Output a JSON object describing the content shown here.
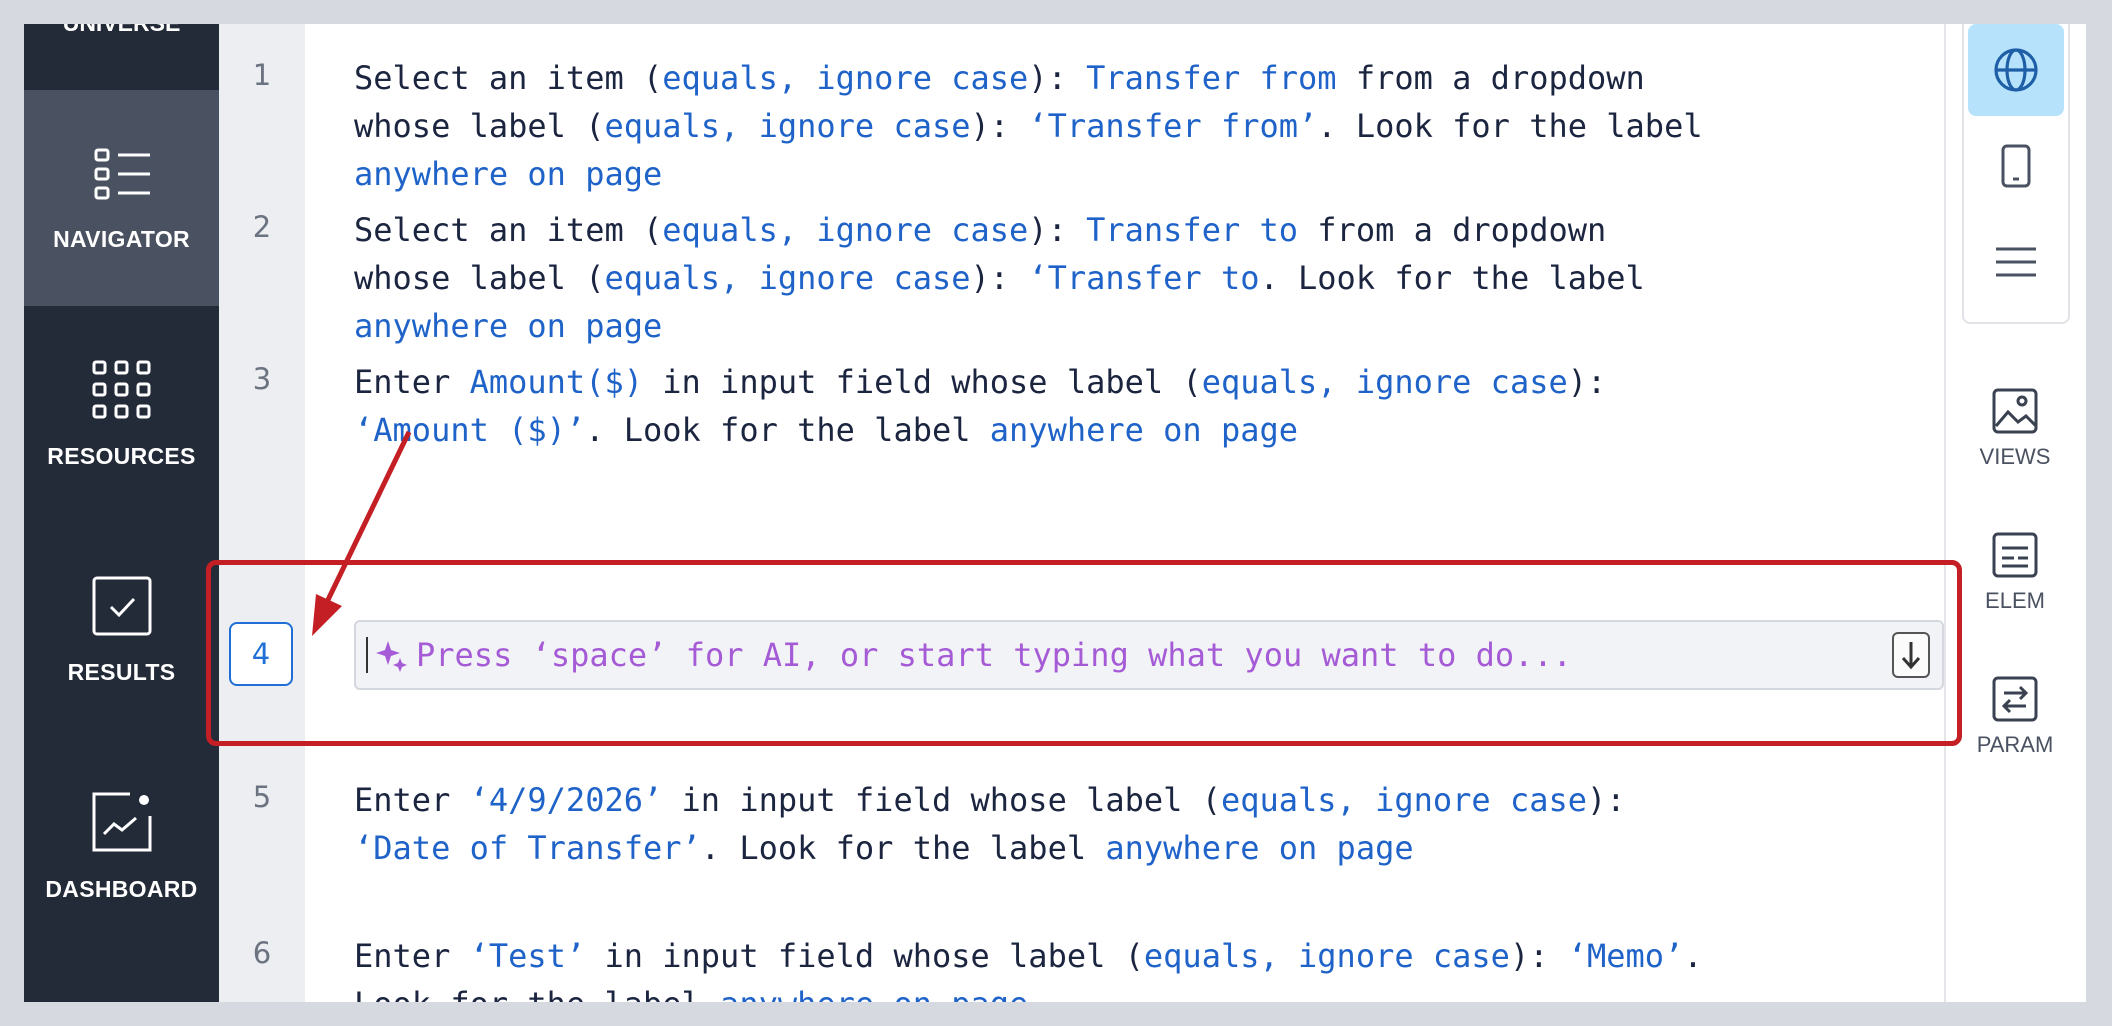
{
  "left_nav": {
    "top_partial_label": "UNIVERSE",
    "items": [
      {
        "label": "NAVIGATOR",
        "icon": "list-icon",
        "active": true
      },
      {
        "label": "RESOURCES",
        "icon": "grid-icon",
        "active": false
      },
      {
        "label": "RESULTS",
        "icon": "checkbox-icon",
        "active": false
      },
      {
        "label": "DASHBOARD",
        "icon": "chart-icon",
        "active": false
      }
    ]
  },
  "steps": [
    {
      "number": "1"
    },
    {
      "number": "2"
    },
    {
      "number": "3"
    },
    {
      "number": "4",
      "active": true
    },
    {
      "number": "5"
    },
    {
      "number": "6"
    }
  ],
  "step_text": {
    "s1": {
      "a": "Select an item (",
      "b": "equals, ignore case",
      "c": "): ",
      "d": "Transfer from",
      "e": " from a dropdown\nwhose label (",
      "f": "equals, ignore case",
      "g": "): ",
      "h": "‘Transfer from’",
      "i": ". Look for the label\n",
      "j": "anywhere on page"
    },
    "s2": {
      "a": "Select an item (",
      "b": "equals, ignore case",
      "c": "): ",
      "d": "Transfer to",
      "e": " from a dropdown\nwhose label (",
      "f": "equals, ignore case",
      "g": "): ",
      "h": "‘Transfer to",
      "i": ". Look for the label\n",
      "j": "anywhere on page"
    },
    "s3": {
      "a": "Enter ",
      "b": "Amount($)",
      "c": " in input field whose label (",
      "d": "equals, ignore case",
      "e": "):\n",
      "f": "‘Amount ($)’",
      "g": ". Look for the label ",
      "h": "anywhere on page"
    },
    "s5": {
      "a": "Enter ",
      "b": "‘4/9/2026’",
      "c": " in input field whose label (",
      "d": "equals, ignore case",
      "e": "):\n",
      "f": "‘Date of Transfer’",
      "g": ". Look for the label ",
      "h": "anywhere on page"
    },
    "s6": {
      "a": "Enter ",
      "b": "‘Test’",
      "c": " in input field whose label (",
      "d": "equals, ignore case",
      "e": "): ",
      "f": "‘Memo’",
      "g": ".\nLook for the label ",
      "h": "anywhere on page"
    }
  },
  "step_input": {
    "placeholder": "Press ‘space’ for AI, or start typing what you want to do..."
  },
  "right_panel": {
    "view_buttons": [
      {
        "icon": "globe-icon",
        "active": true
      },
      {
        "icon": "mobile-icon",
        "active": false
      },
      {
        "icon": "menu-icon",
        "active": false
      }
    ],
    "items": [
      {
        "label": "VIEWS",
        "icon": "image-icon"
      },
      {
        "label": "ELEM",
        "icon": "element-icon"
      },
      {
        "label": "PARAM",
        "icon": "swap-icon"
      }
    ]
  },
  "colors": {
    "nav_bg": "#242b38",
    "nav_active": "#4a5160",
    "keyword": "#1f63c9",
    "placeholder": "#a55bd6",
    "highlight": "#c41f25",
    "active_view": "#b6e3fb"
  }
}
